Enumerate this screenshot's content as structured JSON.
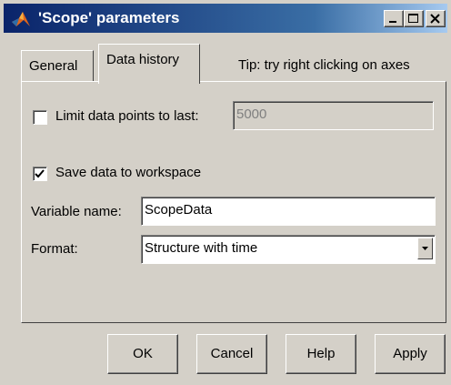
{
  "window": {
    "title": "'Scope' parameters",
    "accent": "#0a246a"
  },
  "titlebar_buttons": [
    {
      "name": "minimize-icon"
    },
    {
      "name": "maximize-icon"
    },
    {
      "name": "close-icon"
    }
  ],
  "tabs": [
    {
      "label": "General",
      "active": false
    },
    {
      "label": "Data history",
      "active": true
    }
  ],
  "tip": "Tip: try right clicking on axes",
  "limit": {
    "label": "Limit data points to last:",
    "checked": false,
    "value": "5000"
  },
  "save": {
    "label": "Save data to workspace",
    "checked": true
  },
  "variable": {
    "label": "Variable name:",
    "value": "ScopeData"
  },
  "format": {
    "label": "Format:",
    "value": "Structure with time"
  },
  "buttons": {
    "ok": "OK",
    "cancel": "Cancel",
    "help": "Help",
    "apply": "Apply"
  }
}
